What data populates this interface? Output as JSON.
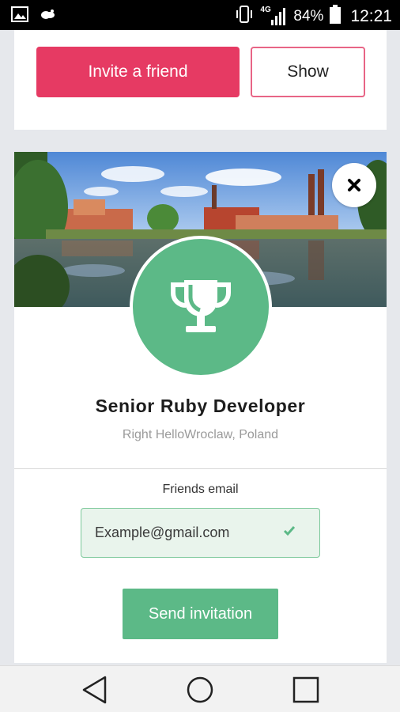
{
  "status_bar": {
    "network": "4G",
    "battery": "84%",
    "time": "12:21",
    "icons": [
      "image-icon",
      "cloud-icon",
      "vibrate-icon",
      "signal-icon",
      "battery-icon"
    ]
  },
  "top_card": {
    "invite_label": "Invite a friend",
    "show_label": "Show"
  },
  "job": {
    "title": "Senior Ruby Developer",
    "location": "Right HelloWroclaw, Poland"
  },
  "invite_form": {
    "email_label": "Friends email",
    "email_value": "Example@gmail.com",
    "send_label": "Send invitation"
  },
  "colors": {
    "accent_red": "#e63a63",
    "accent_green": "#5cb987",
    "field_bg": "#e9f4ec"
  },
  "nav": {
    "icons": [
      "back-icon",
      "home-icon",
      "recents-icon"
    ]
  }
}
